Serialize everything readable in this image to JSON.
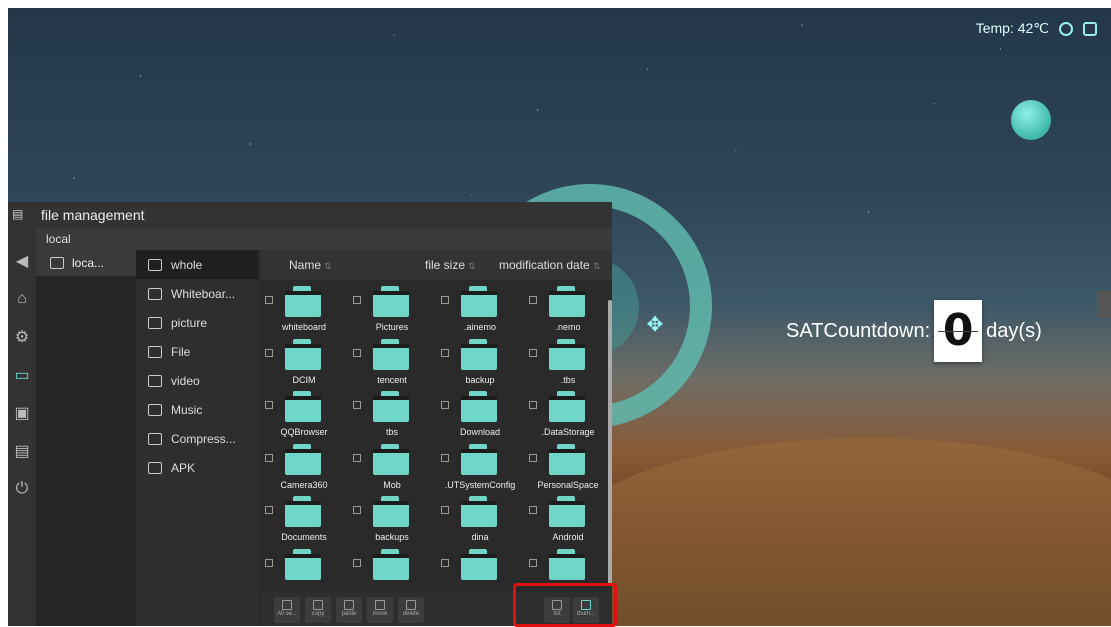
{
  "status_bar": {
    "temp": "Temp: 42℃",
    "icons": [
      "wifi-icon",
      "display-icon"
    ]
  },
  "countdown": {
    "prefix": "SATCountdown:",
    "value": "0",
    "suffix": "day(s)"
  },
  "rail": {
    "items": [
      "back-icon",
      "home-icon",
      "settings-icon",
      "folder-icon",
      "camera-icon",
      "screen-icon",
      "power-icon"
    ],
    "active": 3
  },
  "window": {
    "title": "file management",
    "path": "local",
    "storage": {
      "label": "loca..."
    },
    "categories": [
      {
        "label": "whole",
        "icon": "all-files-icon"
      },
      {
        "label": "Whiteboar...",
        "icon": "whiteboard-icon"
      },
      {
        "label": "picture",
        "icon": "picture-icon"
      },
      {
        "label": "File",
        "icon": "file-icon"
      },
      {
        "label": "video",
        "icon": "video-icon"
      },
      {
        "label": "Music",
        "icon": "music-icon"
      },
      {
        "label": "Compress...",
        "icon": "compress-icon"
      },
      {
        "label": "APK",
        "icon": "apk-icon"
      }
    ],
    "columns": {
      "name": "Name",
      "size": "file size",
      "date": "modification date"
    },
    "folders": [
      "whiteboard",
      "Pictures",
      ".ainemo",
      ".nemo",
      "DCIM",
      "tencent",
      "backup",
      ".tbs",
      "QQBrowser",
      "tbs",
      "Download",
      ".DataStorage",
      "Camera360",
      "Mob",
      ".UTSystemConfig",
      "PersonalSpace",
      "Documents",
      "backups",
      "dina",
      "Android",
      "",
      "",
      "",
      ""
    ],
    "footer_actions": [
      {
        "label": "All se..."
      },
      {
        "label": "copy"
      },
      {
        "label": "paste"
      },
      {
        "label": "move"
      },
      {
        "label": "delete"
      }
    ],
    "view_modes": [
      {
        "label": "list"
      },
      {
        "label": "thum..."
      }
    ]
  }
}
